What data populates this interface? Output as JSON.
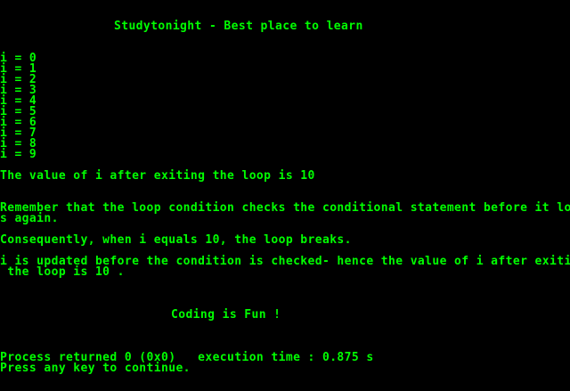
{
  "console": {
    "header": "Studytonight - Best place to learn",
    "loop_lines": [
      "i = 0",
      "i = 1",
      "i = 2",
      "i = 3",
      "i = 4",
      "i = 5",
      "i = 6",
      "i = 7",
      "i = 8",
      "i = 9"
    ],
    "value_after_loop": "The value of i after exiting the loop is 10",
    "remember_line1": "Remember that the loop condition checks the conditional statement before it loop",
    "remember_line2": "s again.",
    "consequently": "Consequently, when i equals 10, the loop breaks.",
    "updated_line1": "i is updated before the condition is checked- hence the value of i after exiting",
    "updated_line2": " the loop is 10 .",
    "coding_fun": "Coding is Fun !",
    "process_returned": "Process returned 0 (0x0)   execution time : 0.875 s",
    "press_any_key": "Press any key to continue."
  },
  "colors": {
    "background": "#000000",
    "text": "#00ff00"
  }
}
